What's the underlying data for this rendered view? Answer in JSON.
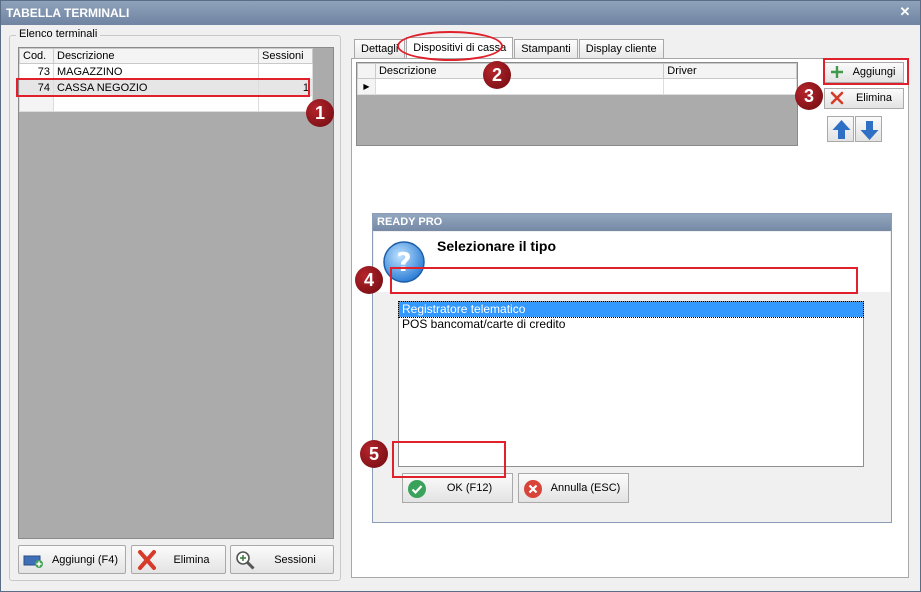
{
  "window": {
    "title": "TABELLA TERMINALI"
  },
  "left": {
    "group_label": "Elenco terminali",
    "columns": [
      "Cod.",
      "Descrizione",
      "Sessioni"
    ],
    "rows": [
      {
        "cod": "73",
        "descrizione": "MAGAZZINO",
        "sessioni": ""
      },
      {
        "cod": "74",
        "descrizione": "CASSA NEGOZIO",
        "sessioni": "1"
      }
    ],
    "buttons": {
      "add": "Aggiungi (F4)",
      "delete": "Elimina",
      "sessions": "Sessioni"
    }
  },
  "tabs": [
    {
      "label": "Dettagli"
    },
    {
      "label": "Dispositivi di cassa"
    },
    {
      "label": "Stampanti"
    },
    {
      "label": "Display cliente"
    }
  ],
  "devices": {
    "columns": [
      "Descrizione",
      "Driver"
    ],
    "buttons": {
      "add": "Aggiungi",
      "delete": "Elimina"
    }
  },
  "dialog": {
    "title": "READY PRO",
    "prompt": "Selezionare il tipo",
    "options": [
      "Registratore telematico",
      "POS bancomat/carte di credito"
    ],
    "ok": "OK (F12)",
    "cancel": "Annulla (ESC)"
  },
  "markers": [
    "1",
    "2",
    "3",
    "4",
    "5"
  ],
  "colors": {
    "highlight": "#e0202a",
    "marker": "#8b1016",
    "selection": "#3399ff",
    "titlebar": "#7d91ad"
  }
}
